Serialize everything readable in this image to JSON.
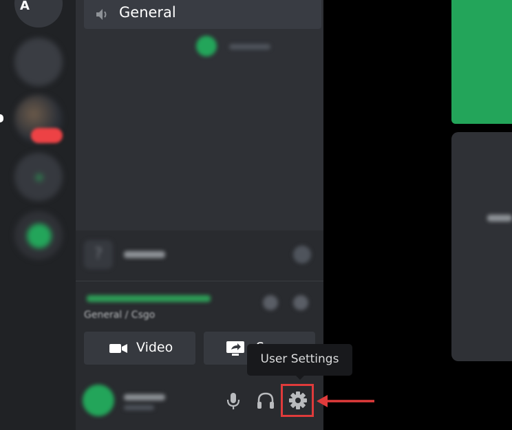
{
  "colors": {
    "rail_bg": "#202225",
    "panel_bg": "#2f3136",
    "footer_bg": "#292b2f",
    "accent_green": "#23a55a",
    "highlight_red": "#e03b3b",
    "tooltip_bg": "#18191c"
  },
  "servers": [
    {
      "icon": "server-top-icon",
      "label": "A"
    },
    {
      "icon": "server-2-icon"
    },
    {
      "icon": "server-3-icon",
      "unread": true
    },
    {
      "icon": "server-4-icon"
    },
    {
      "icon": "server-5-icon"
    }
  ],
  "voice_channel": {
    "icon": "speaker-icon",
    "name": "General"
  },
  "voice_connection": {
    "subtitle": "General / Csgo",
    "buttons": {
      "video": {
        "icon": "camera-icon",
        "label": "Video"
      },
      "screen": {
        "icon": "screen-share-icon",
        "label": "S"
      }
    }
  },
  "user_area": {
    "buttons": [
      {
        "icon": "microphone-icon"
      },
      {
        "icon": "headphones-icon"
      },
      {
        "icon": "gear-icon"
      }
    ]
  },
  "tooltip": {
    "text": "User Settings"
  }
}
